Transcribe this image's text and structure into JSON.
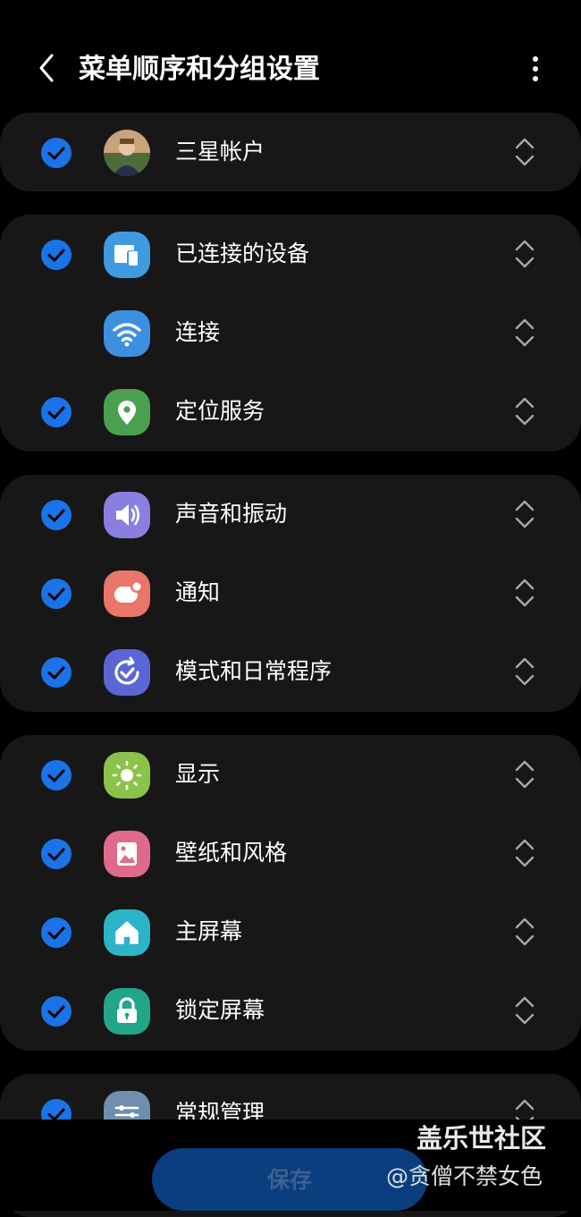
{
  "header": {
    "title": "菜单顺序和分组设置"
  },
  "groups": [
    {
      "items": [
        {
          "label": "三星帐户",
          "checked": true,
          "icon": "samsung-account-avatar"
        }
      ]
    },
    {
      "items": [
        {
          "label": "已连接的设备",
          "checked": true,
          "icon": "connected-devices-icon"
        },
        {
          "label": "连接",
          "checked": false,
          "icon": "wifi-icon"
        },
        {
          "label": "定位服务",
          "checked": true,
          "icon": "location-pin-icon"
        }
      ]
    },
    {
      "items": [
        {
          "label": "声音和振动",
          "checked": true,
          "icon": "speaker-icon"
        },
        {
          "label": "通知",
          "checked": true,
          "icon": "notification-icon"
        },
        {
          "label": "模式和日常程序",
          "checked": true,
          "icon": "modes-routines-icon"
        }
      ]
    },
    {
      "items": [
        {
          "label": "显示",
          "checked": true,
          "icon": "sun-icon"
        },
        {
          "label": "壁纸和风格",
          "checked": true,
          "icon": "wallpaper-icon"
        },
        {
          "label": "主屏幕",
          "checked": true,
          "icon": "home-icon"
        },
        {
          "label": "锁定屏幕",
          "checked": true,
          "icon": "lock-icon"
        }
      ]
    },
    {
      "items": [
        {
          "label": "常规管理",
          "checked": true,
          "icon": "sliders-icon"
        }
      ]
    }
  ],
  "footer": {
    "save_label": "保存"
  },
  "watermark": {
    "line1": "盖乐世社区",
    "line2": "@贪僧不禁女色"
  },
  "colors": {
    "accent": "#1a73e8",
    "card": "#171717",
    "background": "#000000"
  }
}
